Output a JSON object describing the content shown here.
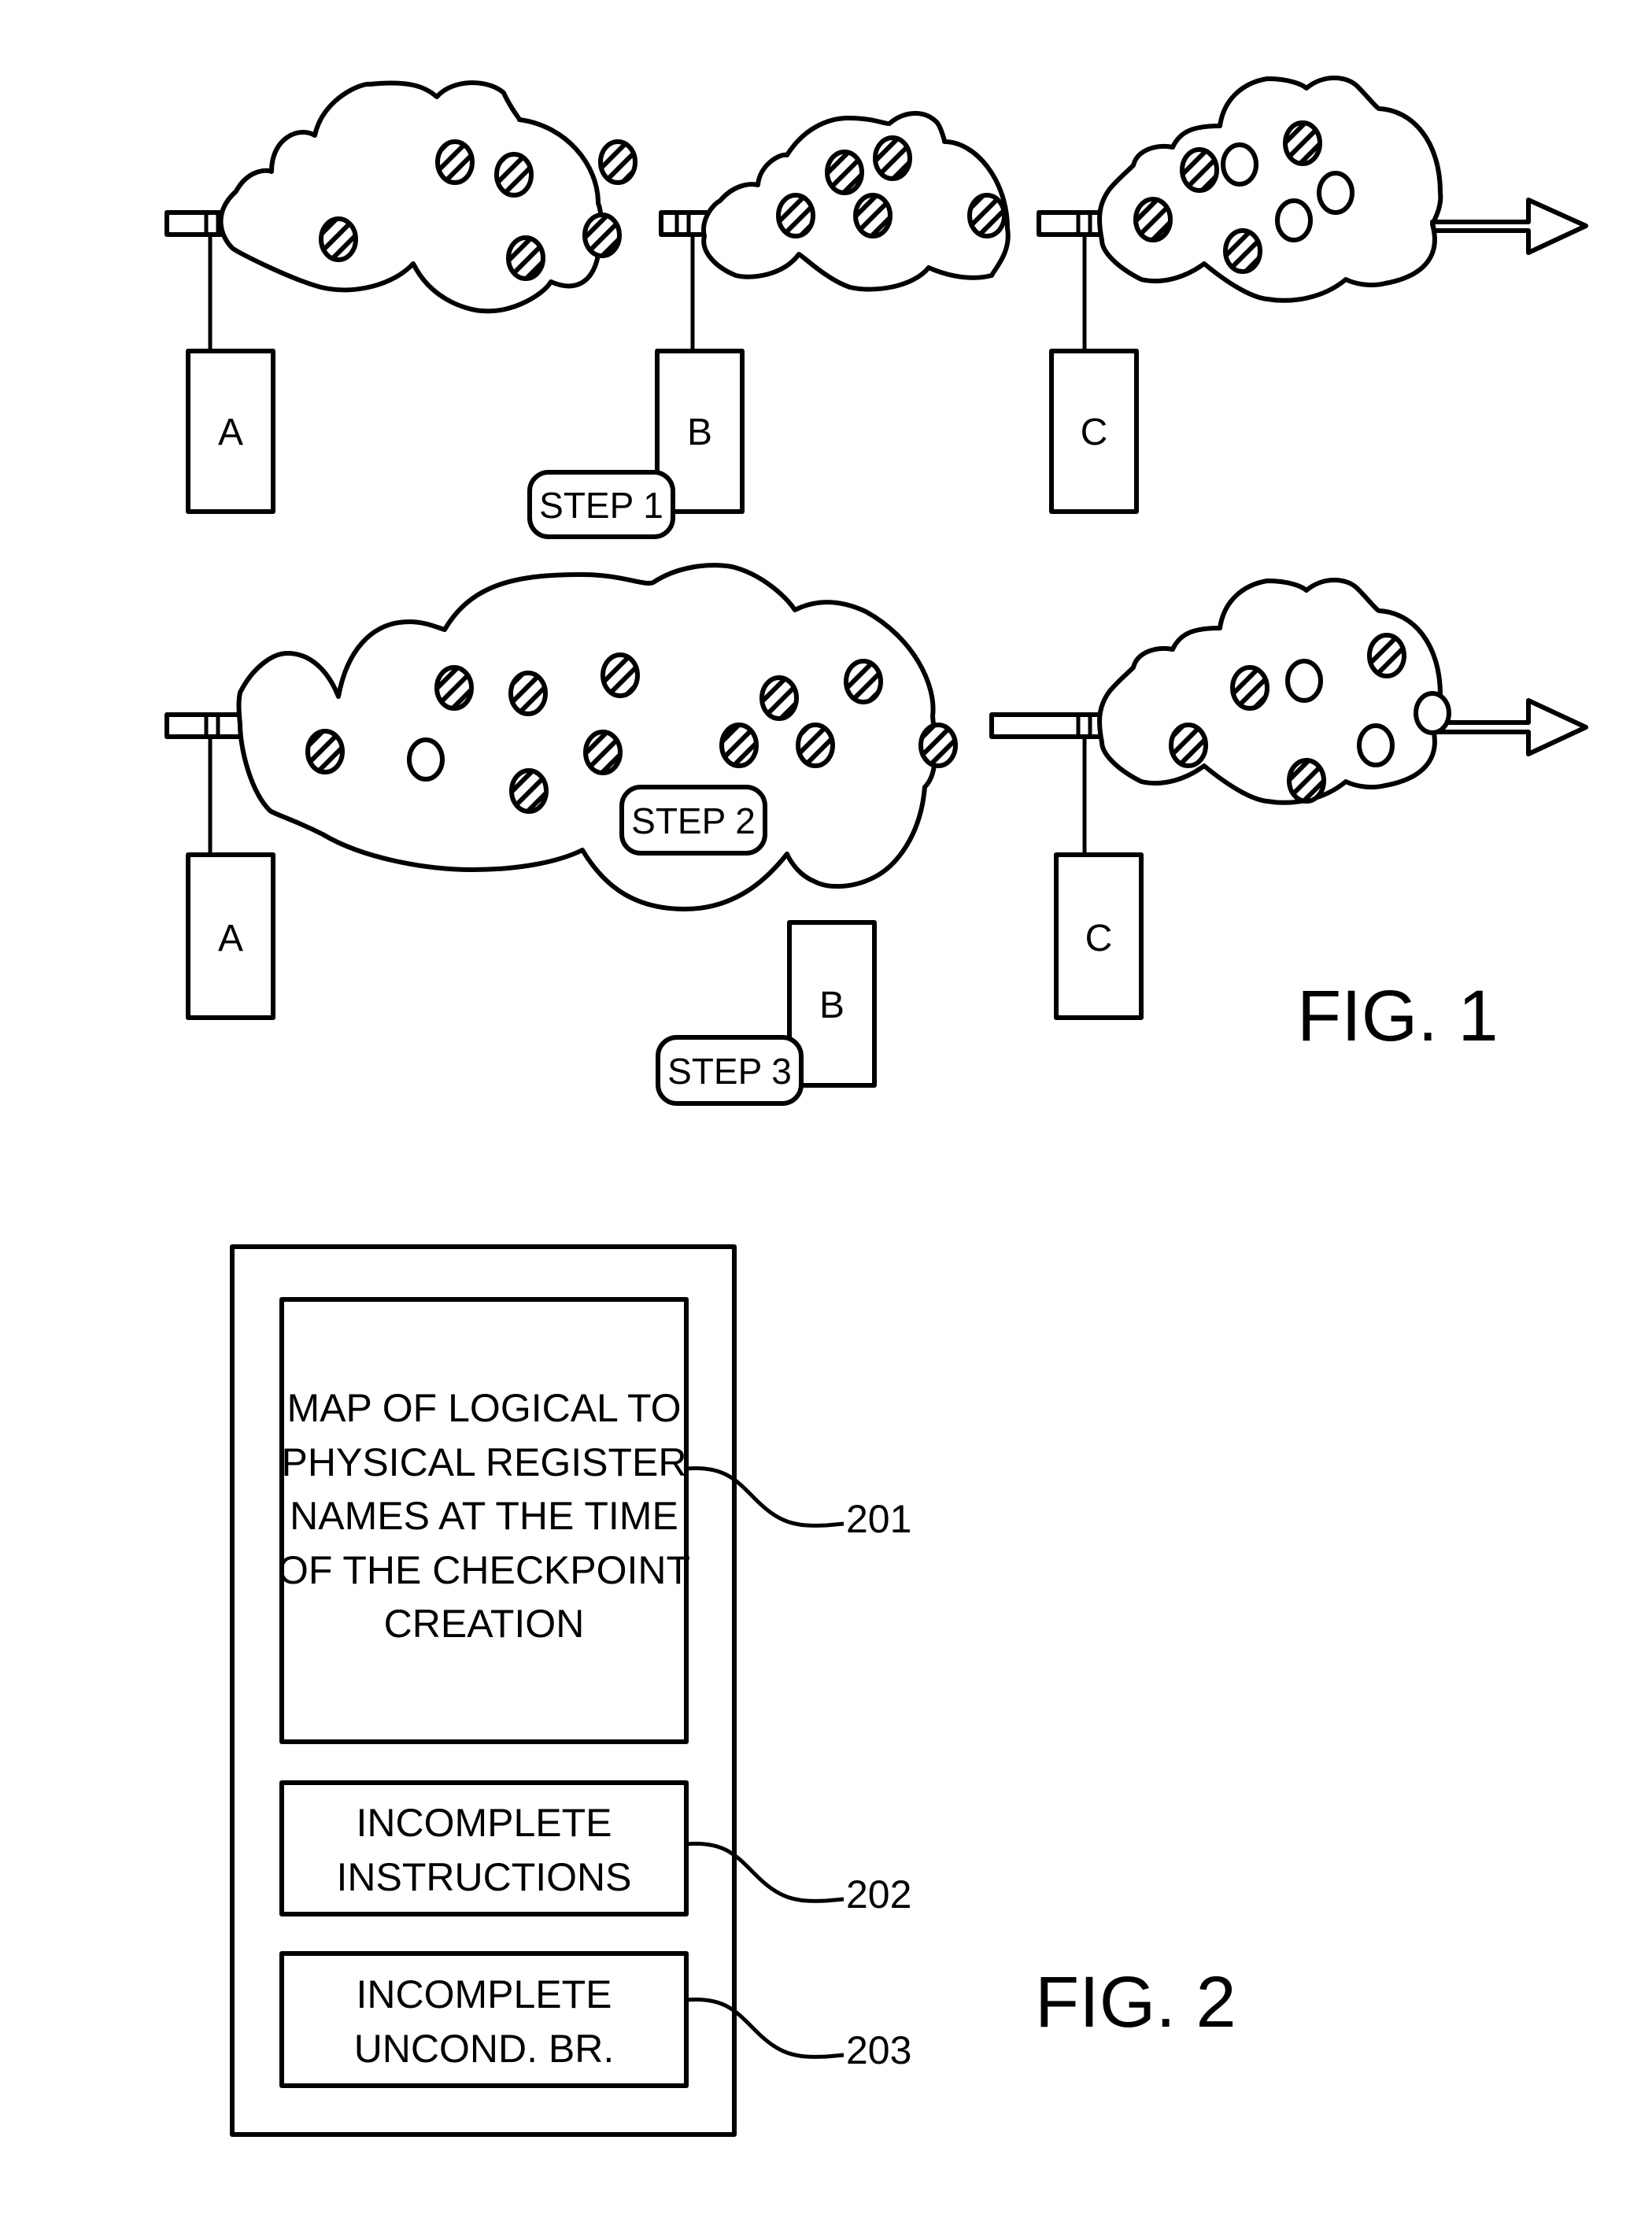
{
  "fig1": {
    "caption": "FIG. 1",
    "top_row": {
      "checkpoints": [
        {
          "label": "A"
        },
        {
          "label": "B"
        },
        {
          "label": "C"
        }
      ],
      "step_badge": "STEP 1",
      "clouds": [
        {
          "hatched": 6,
          "empty": 0
        },
        {
          "hatched": 5,
          "empty": 0
        },
        {
          "hatched": 4,
          "empty": 3
        }
      ]
    },
    "bottom_row": {
      "checkpoints": [
        {
          "label": "A"
        },
        {
          "label": "C"
        },
        {
          "label": "B"
        }
      ],
      "step_badges": [
        "STEP 2",
        "STEP 3"
      ],
      "clouds": [
        {
          "hatched": 11,
          "empty": 1
        },
        {
          "hatched": 4,
          "empty": 3
        }
      ]
    }
  },
  "fig2": {
    "caption": "FIG. 2",
    "blocks": [
      {
        "lines": [
          "MAP OF LOGICAL TO",
          "PHYSICAL REGISTER",
          "NAMES AT THE TIME",
          "OF THE CHECKPOINT",
          "CREATION"
        ],
        "ref": "201"
      },
      {
        "lines": [
          "INCOMPLETE",
          "INSTRUCTIONS"
        ],
        "ref": "202"
      },
      {
        "lines": [
          "INCOMPLETE",
          "UNCOND. BR."
        ],
        "ref": "203"
      }
    ]
  }
}
